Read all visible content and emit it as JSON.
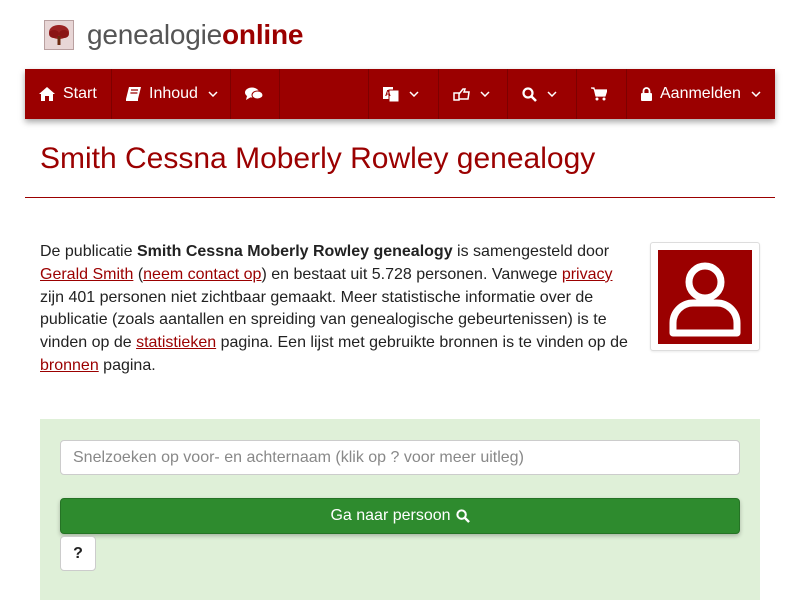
{
  "brand": {
    "part1": "genealogie",
    "part2": "online",
    "logo_icon": "tree-icon"
  },
  "nav": {
    "start": {
      "label": "Start",
      "icon": "home-icon"
    },
    "inhoud": {
      "label": "Inhoud",
      "icon": "book-icon"
    },
    "chat": {
      "icon": "comments-icon"
    },
    "language": {
      "icon": "language-icon"
    },
    "share": {
      "icon": "share-icon"
    },
    "search": {
      "icon": "search-icon"
    },
    "cart": {
      "icon": "cart-icon"
    },
    "login": {
      "label": "Aanmelden",
      "icon": "lock-icon"
    }
  },
  "page": {
    "title": "Smith Cessna Moberly Rowley genealogy"
  },
  "intro": {
    "t1": "De publicatie ",
    "pub_name": "Smith Cessna Moberly Rowley genealogy",
    "t2": " is samengesteld door ",
    "author": "Gerald Smith",
    "t3": " (",
    "contact": "neem contact op",
    "t4": ") en bestaat uit 5.728 personen. Vanwege ",
    "privacy": "privacy",
    "t5": " zijn 401 personen niet zichtbaar gemaakt. Meer statistische informatie over de publicatie (zoals aantallen en spreiding van genealogische gebeurtenissen) is te vinden op de ",
    "stats": "statistieken",
    "t6": " pagina. Een lijst met gebruikte bronnen is te vinden op de ",
    "sources": "bronnen",
    "t7": " pagina."
  },
  "search": {
    "placeholder": "Snelzoeken op voor- en achternaam (klik op ? voor meer uitleg)",
    "button_label": "Ga naar persoon",
    "help_label": "?"
  },
  "colors": {
    "brand": "#9b0000",
    "panel": "#dff0d8",
    "button": "#2e8b2e"
  }
}
